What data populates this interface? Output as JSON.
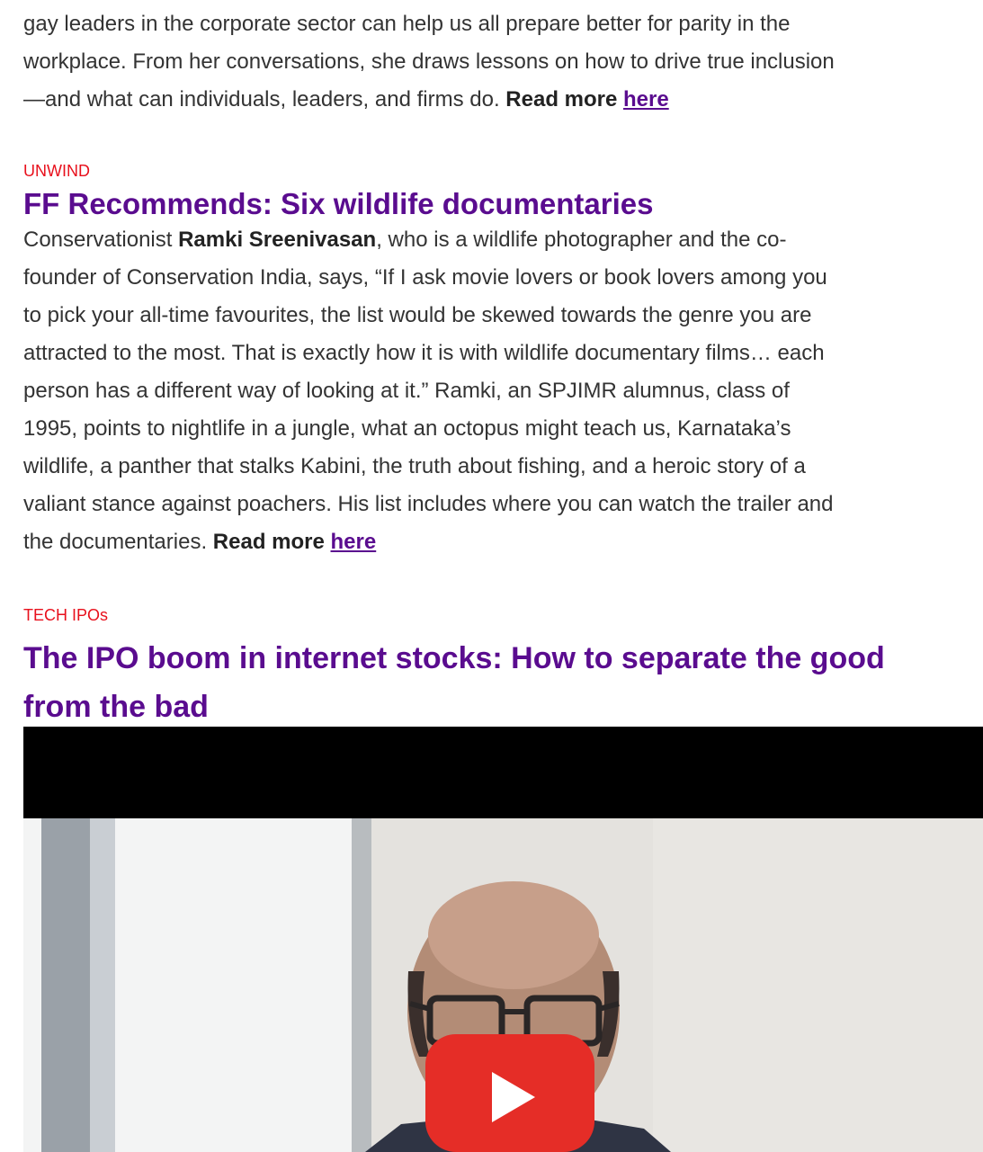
{
  "intro": {
    "lines": [
      "gay leaders in the corporate sector can help us all prepare better for parity in the",
      "workplace. From her conversations, she draws lessons on how to drive true inclusion",
      "—and what can individuals, leaders, and firms do. "
    ],
    "read_more": "Read more",
    "link": "here"
  },
  "unwind": {
    "tag": "UNWIND",
    "title": "FF Recommends: Six wildlife documentaries",
    "line1_prefix": "Conservationist ",
    "line1_bold": "Ramki Sreenivasan",
    "line1_suffix": ", who is a wildlife photographer and the co-",
    "lines": [
      "founder of Conservation India, says, “If I ask movie lovers or book lovers among you",
      "to pick your all-time favourites, the list would be skewed towards the genre you are",
      "attracted to the most. That is exactly how it is with wildlife documentary films… each",
      "person has a different way of looking at it.” Ramki, an SPJIMR alumnus, class of",
      "1995, points to nightlife in a jungle, what an octopus might teach us, Karnataka’s",
      "wildlife, a panther that stalks Kabini, the truth about fishing, and a heroic story of a",
      "valiant stance against poachers. His list includes where you can watch the trailer and"
    ],
    "last_line": "the documentaries. ",
    "read_more": "Read more",
    "link": "here"
  },
  "tech": {
    "tag": "TECH IPOs",
    "title_line1": "The IPO boom in internet stocks: How to separate the good",
    "title_line2": "from the bad"
  },
  "colors": {
    "headline": "#5a0c8f",
    "tag": "#e8101c",
    "play_button": "#e52d27"
  },
  "video": {
    "play_icon": "play-icon"
  }
}
